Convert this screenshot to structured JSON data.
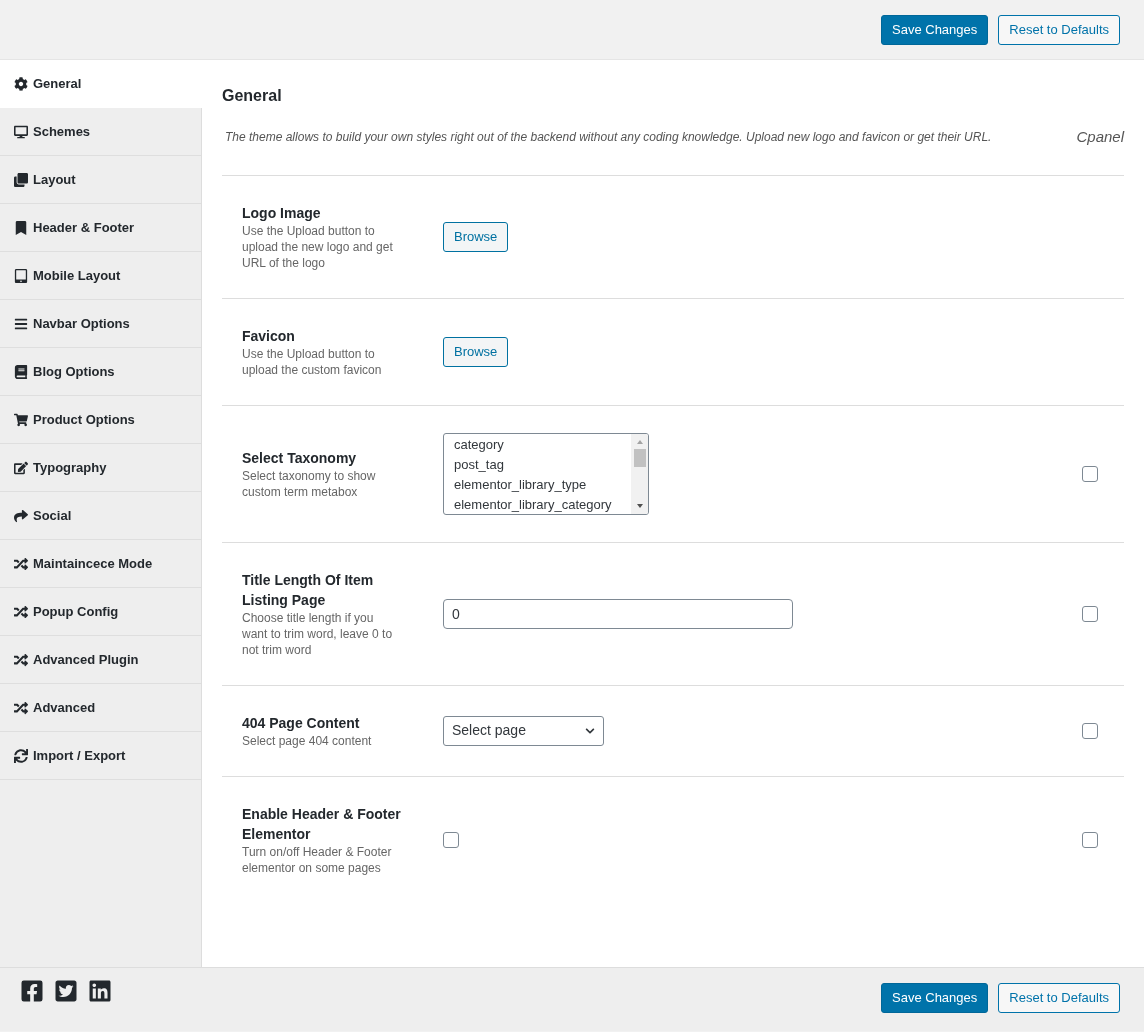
{
  "header_buttons": [
    {
      "label": "Save Changes",
      "kind": "primary"
    },
    {
      "label": "Reset to Defaults",
      "kind": "secondary"
    }
  ],
  "sidebar": {
    "items": [
      {
        "label": "General",
        "selected": true
      },
      {
        "label": "Schemes",
        "selected": false
      },
      {
        "label": "Layout",
        "selected": false
      },
      {
        "label": "Header & Footer",
        "selected": false
      },
      {
        "label": "Mobile Layout",
        "selected": false
      },
      {
        "label": "Navbar Options",
        "selected": false
      },
      {
        "label": "Blog Options",
        "selected": false
      },
      {
        "label": "Product Options",
        "selected": false
      },
      {
        "label": "Typography",
        "selected": false
      },
      {
        "label": "Social",
        "selected": false
      },
      {
        "label": "Maintaincece Mode",
        "selected": false
      },
      {
        "label": "Popup Config",
        "selected": false
      },
      {
        "label": "Advanced Plugin",
        "selected": false
      },
      {
        "label": "Advanced",
        "selected": false
      },
      {
        "label": "Import / Export",
        "selected": false
      }
    ]
  },
  "section": {
    "title": "General",
    "description": "The theme allows to build your own styles right out of the backend without any coding knowledge. Upload new logo and favicon or get their URL.",
    "tag": "Cpanel"
  },
  "rows": [
    {
      "title": "Logo Image",
      "description": "Use the Upload button to upload the new logo and get URL of the logo",
      "kind": "upload",
      "button": "Browse"
    },
    {
      "title": "Favicon",
      "description": "Use the Upload button to upload the custom favicon",
      "kind": "upload",
      "button": "Browse"
    },
    {
      "title": "Select Taxonomy",
      "description": "Select taxonomy to show custom term metabox",
      "kind": "multiselect",
      "options": [
        "category",
        "post_tag",
        "elementor_library_type",
        "elementor_library_category"
      ],
      "side_checked": false
    },
    {
      "title": "Title Length Of Item Listing Page",
      "description": "Choose title length if you want to trim word, leave 0 to not trim word",
      "kind": "text",
      "value": "0",
      "side_checked": false
    },
    {
      "title": "404 Page Content",
      "description": "Select page 404 content",
      "kind": "select",
      "value": "Select page",
      "side_checked": false
    },
    {
      "title": "Enable Header & Footer Elementor",
      "description": "Turn on/off Header & Footer elementor on some pages",
      "kind": "checkbox",
      "checked": false,
      "side_checked": false
    }
  ],
  "footer_buttons": [
    {
      "label": "Save Changes",
      "kind": "primary"
    },
    {
      "label": "Reset to Defaults",
      "kind": "secondary"
    }
  ]
}
